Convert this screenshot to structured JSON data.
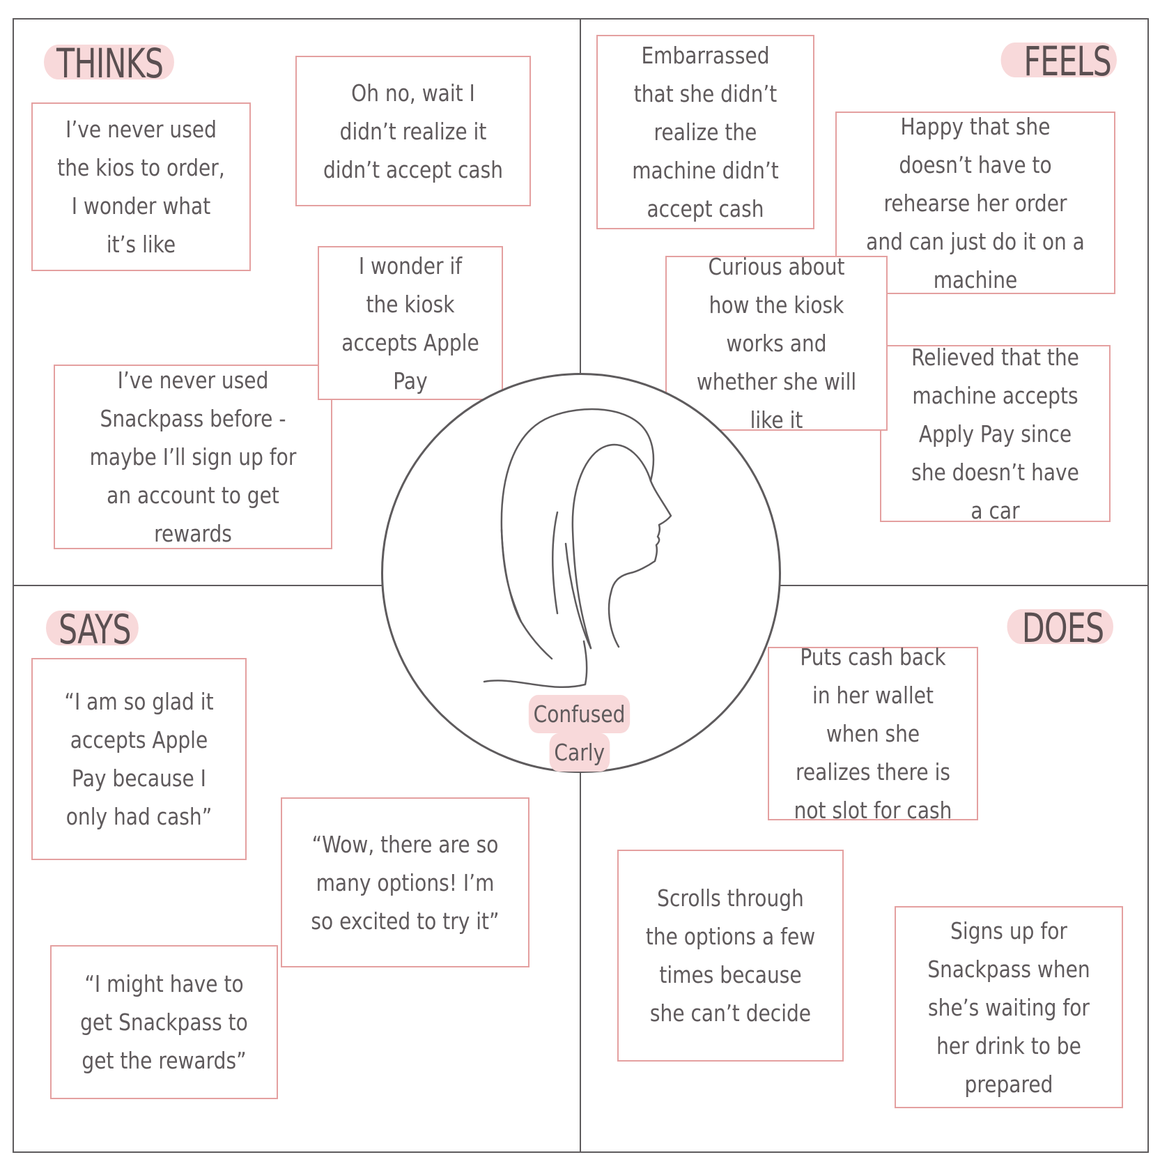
{
  "quadrants": {
    "thinks": {
      "title": "THINKS",
      "notes": [
        "I’ve never used the kios to order, I wonder what it’s like",
        "Oh no, wait I didn’t realize it didn’t accept cash",
        "I wonder if the kiosk accepts Apple Pay",
        "I’ve never used Snackpass before - maybe I’ll sign up for an account to get rewards"
      ]
    },
    "feels": {
      "title": "FEELS",
      "notes": [
        "Embarrassed that she didn’t realize the machine didn’t accept cash",
        "Happy that she doesn’t have to rehearse her order and can just do it on a machine",
        "Curious about how the kiosk works and whether she will like it",
        "Relieved that the machine accepts Apply Pay since she doesn’t have a car"
      ]
    },
    "says": {
      "title": "SAYS",
      "notes": [
        "“I am so glad it accepts Apple Pay because I only had cash”",
        "“Wow, there are so many options! I’m so excited to try it”",
        "“I might have to get Snackpass to get the rewards”"
      ]
    },
    "does": {
      "title": "DOES",
      "notes": [
        "Puts cash back in her wallet when she realizes there is not slot for cash",
        "Scrolls through the options a few times because she can’t decide",
        "Signs up for Snackpass when she’s waiting for her drink to be prepared"
      ]
    }
  },
  "persona": {
    "name_line1": "Confused",
    "name_line2": "Carly",
    "icon": "woman-profile-icon"
  },
  "colors": {
    "frame": "#5e5b5d",
    "note_border": "#e4a0a0",
    "highlight": "#f8d9da",
    "text": "#5f5a5c"
  }
}
